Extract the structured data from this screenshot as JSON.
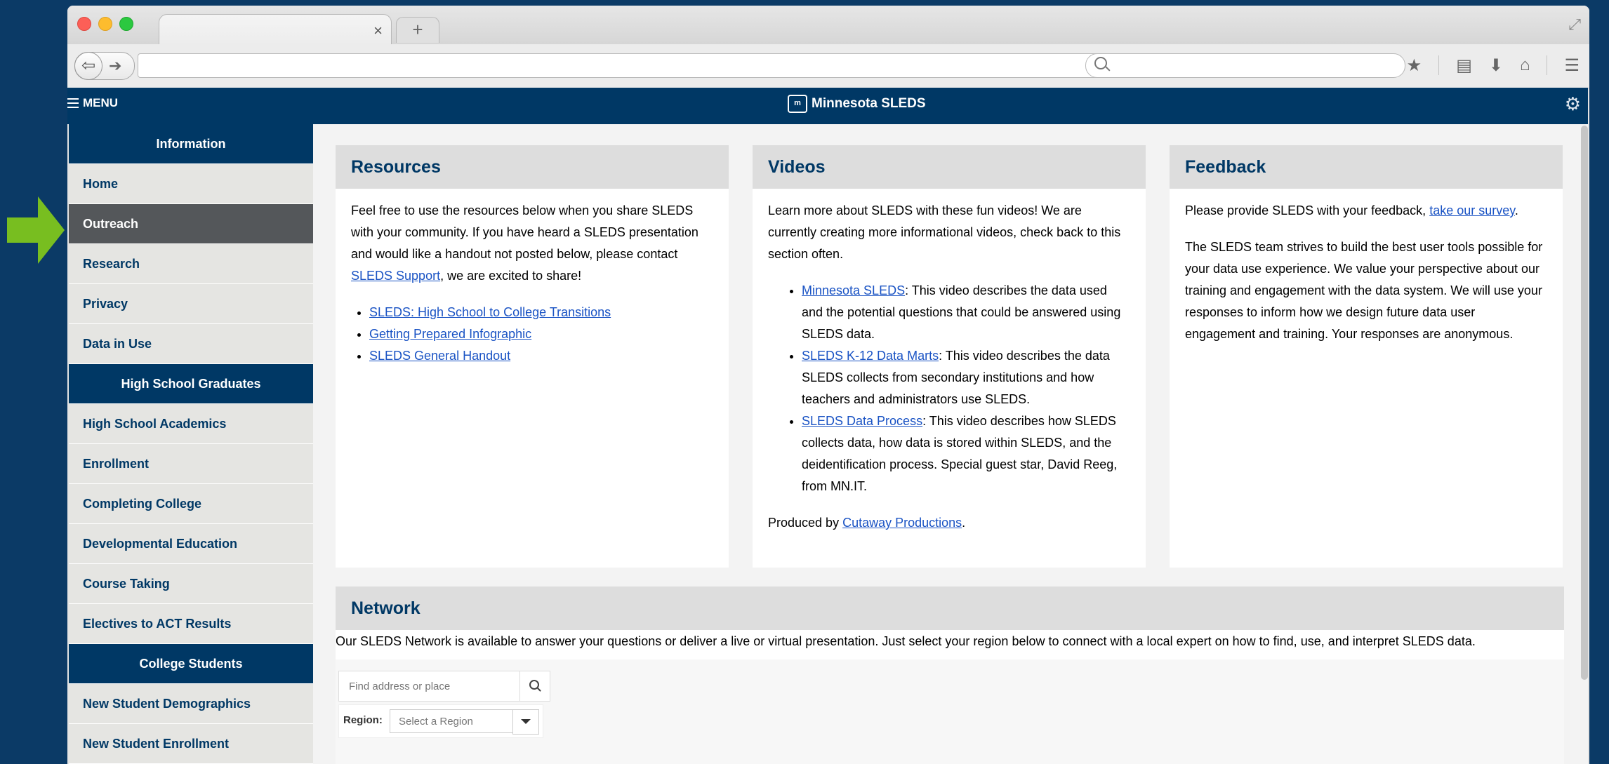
{
  "header": {
    "menu_label": "MENU",
    "brand_title": "Minnesota SLEDS",
    "brand_logo": "m"
  },
  "browser": {
    "close_glyph": "×",
    "newtab_glyph": "+"
  },
  "sidebar": {
    "sections": [
      {
        "title": "Information",
        "items": [
          {
            "label": "Home"
          },
          {
            "label": "Outreach",
            "active": true
          },
          {
            "label": "Research"
          },
          {
            "label": "Privacy"
          },
          {
            "label": "Data in Use"
          }
        ]
      },
      {
        "title": "High School Graduates",
        "items": [
          {
            "label": "High School Academics"
          },
          {
            "label": "Enrollment"
          },
          {
            "label": "Completing College"
          },
          {
            "label": "Developmental Education"
          },
          {
            "label": "Course Taking"
          },
          {
            "label": "Electives to ACT Results"
          }
        ]
      },
      {
        "title": "College Students",
        "items": [
          {
            "label": "New Student Demographics"
          },
          {
            "label": "New Student Enrollment"
          }
        ]
      }
    ]
  },
  "resources": {
    "title": "Resources",
    "intro_before": "Feel free to use the resources below when you share SLEDS with your community. If you have heard a SLEDS presentation and would like a handout not posted below, please contact ",
    "intro_link": "SLEDS Support",
    "intro_after": ", we are excited to share!",
    "links": [
      "SLEDS: High School to College Transitions",
      "Getting Prepared Infographic",
      "SLEDS General Handout"
    ]
  },
  "videos": {
    "title": "Videos",
    "intro": "Learn more about SLEDS with these fun videos! We are currently creating more informational videos, check back to this section often.",
    "items": [
      {
        "link": "Minnesota SLEDS",
        "text": ": This video describes the data used and the potential questions that could be answered using SLEDS data."
      },
      {
        "link": "SLEDS K-12 Data Marts",
        "text": ": This video describes the data SLEDS collects from secondary institutions and how teachers and administrators use SLEDS."
      },
      {
        "link": "SLEDS Data Process",
        "text": ": This video describes how SLEDS collects data, how data is stored within SLEDS, and the deidentification process. Special guest star, David Reeg, from MN.IT."
      }
    ],
    "produced_before": "Produced by ",
    "produced_link": "Cutaway Productions",
    "produced_after": "."
  },
  "feedback": {
    "title": "Feedback",
    "p1_before": "Please provide SLEDS with your feedback, ",
    "p1_link": "take our survey",
    "p1_after": ".",
    "p2": "The SLEDS team strives to build the best user tools possible for your data use experience. We value your perspective about our training and engagement with the data system. We will use your responses to inform how we design future data user engagement and training. Your responses are anonymous."
  },
  "network": {
    "title": "Network",
    "text": "Our SLEDS Network is available to answer your questions or deliver a live or virtual presentation. Just select your region below to connect with a local expert on how to find, use, and interpret SLEDS data.",
    "search_placeholder": "Find address or place",
    "region_label": "Region:",
    "region_selected": "Select a Region"
  },
  "colors": {
    "brand_navy": "#003865",
    "pointer_green": "#78be20",
    "active_item": "#54575a",
    "link": "#1a53c4"
  }
}
